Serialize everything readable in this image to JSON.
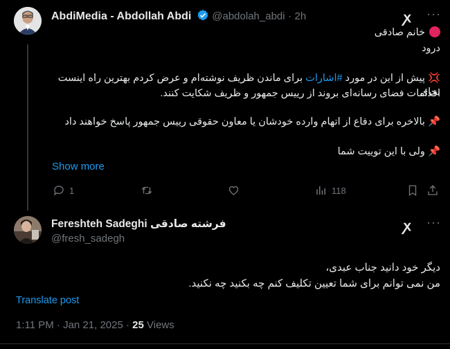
{
  "tweet1": {
    "display_name": "AbdiMedia - Abdollah Abdi",
    "handle": "@abdolah_abdi",
    "separator": "·",
    "time": "2h",
    "lines": {
      "l1": "خانم صادقی",
      "l2": "درود",
      "l3_pre": "پیش از این در مورد ",
      "hashtag": "#اشارات",
      "l3_post": " برای ماندن ظریف نوشته‌ام و عرض کردم بهترین راه اینست بجای",
      "l4": "اقدامات فضای رسانه‌ای بروند از رییس جمهور و ظریف شکایت کنند.",
      "l5": "بالاخره برای دفاع از اتهام وارده خودشان یا معاون حقوقی رییس جمهور پاسخ خواهند داد",
      "l6": "ولی با این توییت شما"
    },
    "show_more": "Show more",
    "stats": {
      "replies": "1",
      "views": "118"
    }
  },
  "tweet2": {
    "display_name": "Fereshteh Sadeghi فرشته صادقی",
    "handle": "@fresh_sadegh",
    "lines": {
      "l1": "دیگر خود دانید جناب عبدی،",
      "l2": "من نمی توانم برای شما تعیین تکلیف کنم چه بکنید چه نکنید."
    },
    "translate": "Translate post",
    "meta": {
      "time": "1:11 PM · Jan 21, 2025 · ",
      "views_count": "25",
      "views_label": " Views"
    }
  },
  "colors": {
    "accent": "#1d9bf0",
    "bg": "#000000",
    "text": "#e7e9ea",
    "muted": "#71767b",
    "red_circle": "#e0245e"
  },
  "icons": [
    "verified-badge-icon",
    "grok-icon",
    "more-icon",
    "reply-icon",
    "retweet-icon",
    "like-icon",
    "views-icon",
    "bookmark-icon",
    "share-icon",
    "red-circle-icon",
    "collision-icon",
    "pushpin-icon"
  ]
}
